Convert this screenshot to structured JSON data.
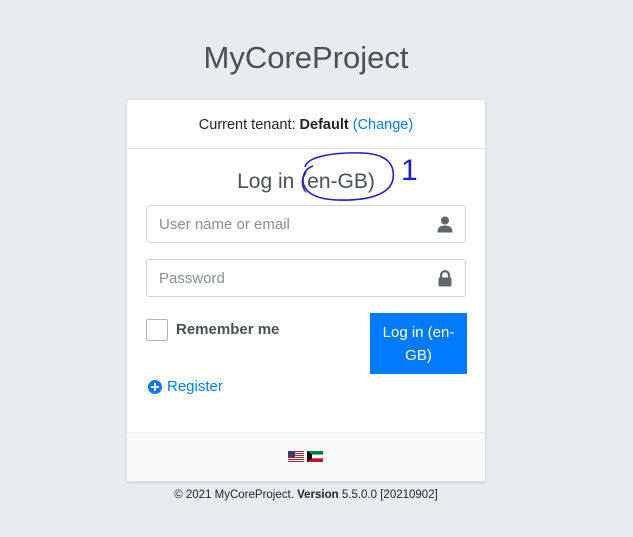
{
  "brand": {
    "title": "MyCoreProject"
  },
  "tenant": {
    "label": "Current tenant:",
    "name": "Default",
    "open_paren": "(",
    "change_link": "Change",
    "close_paren": ")"
  },
  "login": {
    "heading": "Log in",
    "culture": "(en-GB)",
    "annotation": "1",
    "username_placeholder": "User name or email",
    "password_placeholder": "Password",
    "remember_label": "Remember me",
    "submit_label": "Log in (en-GB)",
    "register_label": "Register"
  },
  "languages": [
    {
      "icon": "us-flag-icon"
    },
    {
      "icon": "kuwait-flag-icon"
    }
  ],
  "footer": {
    "copyright": "© 2021 MyCoreProject.",
    "version_label": "Version",
    "version_value": "5.5.0.0 [20210902]"
  },
  "colors": {
    "primary": "#007bff",
    "background": "#e9ecef",
    "annotation": "#1a1ad8"
  }
}
